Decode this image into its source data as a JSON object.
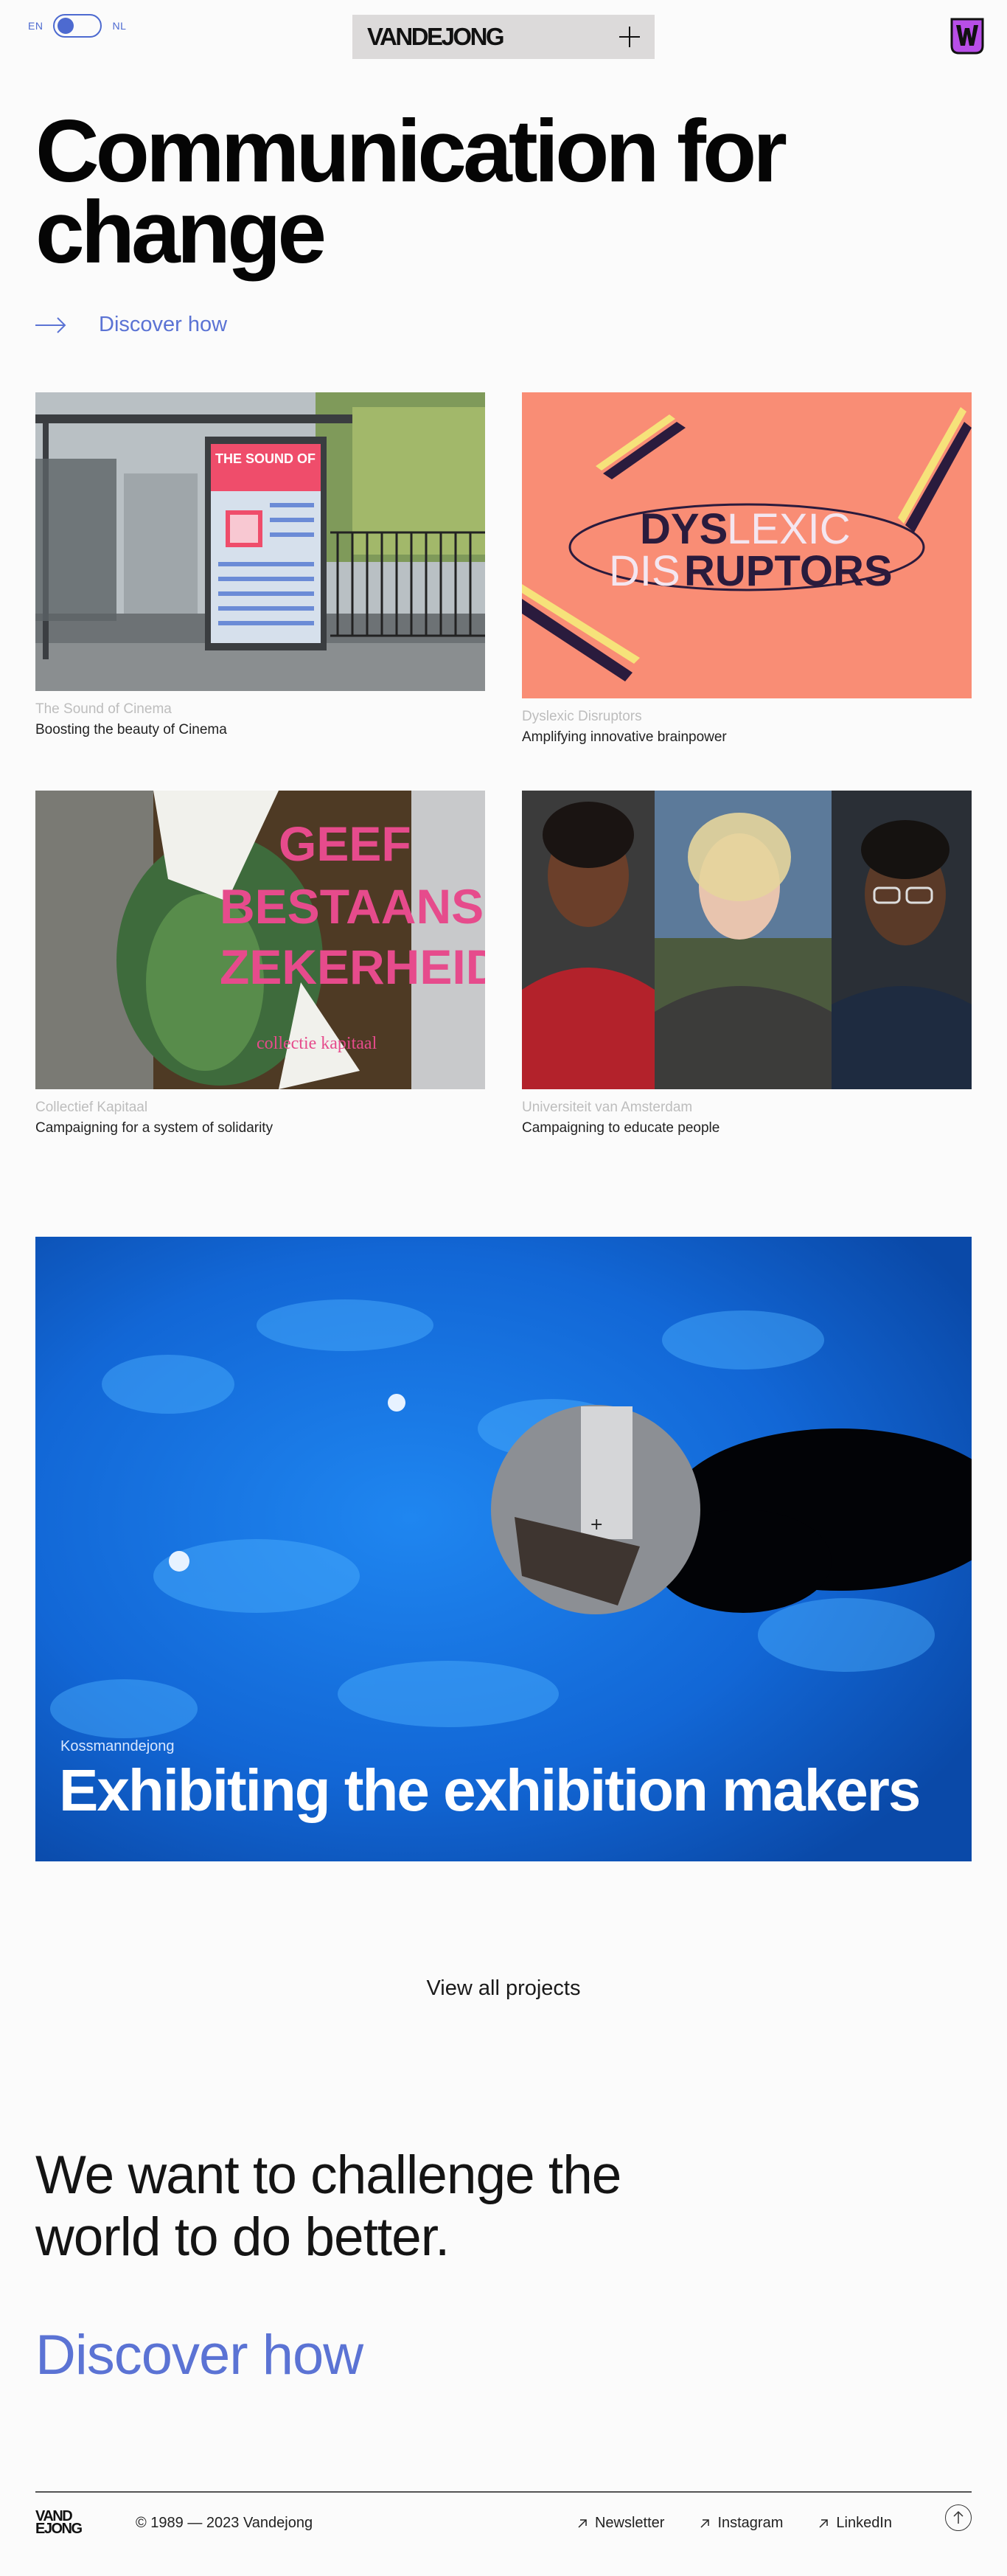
{
  "header": {
    "lang_en": "EN",
    "lang_nl": "NL",
    "logo": "VANDEJONG",
    "menu_icon": "plus-icon",
    "badge_icon": "w-badge-icon",
    "badge_color": "#b84ee8"
  },
  "hero": {
    "line1": "Communication for",
    "line2": "change",
    "discover_label": "Discover how"
  },
  "projects": [
    {
      "client": "The Sound of Cinema",
      "desc": "Boosting the beauty of Cinema"
    },
    {
      "client": "Dyslexic Disruptors",
      "desc": "Amplifying innovative brainpower"
    },
    {
      "client": "Collectief Kapitaal",
      "desc": "Campaigning for a system of solidarity"
    },
    {
      "client": "Universiteit van Amsterdam",
      "desc": "Campaigning to educate people"
    }
  ],
  "posters": {
    "sound_title": "THE SOUND OF",
    "dys_1a": "DYS",
    "dys_1b": "LEXIC",
    "dys_2a": "DIS",
    "dys_2b": "RUPTORS",
    "geef_1": "GEEF",
    "geef_2": "BESTAANS",
    "geef_3": "ZEKERHEID",
    "geef_sub": "collectie kapitaal"
  },
  "feature": {
    "client": "Kossmanndejong",
    "title": "Exhibiting the exhibition makers"
  },
  "view_all": "View all projects",
  "tagline": {
    "line1": "We want to challenge the",
    "line2": "world to do better."
  },
  "discover_big": "Discover how",
  "footer": {
    "logo_line1": "VAND",
    "logo_line2": "EJONG",
    "copyright": "© 1989 — 2023 Vandejong",
    "links": [
      "Newsletter",
      "Instagram",
      "LinkedIn"
    ]
  },
  "colors": {
    "accent": "#5b73d4",
    "salmon": "#f98d75",
    "navy": "#2a1b3d",
    "feature_blue": "#1a73e8"
  }
}
